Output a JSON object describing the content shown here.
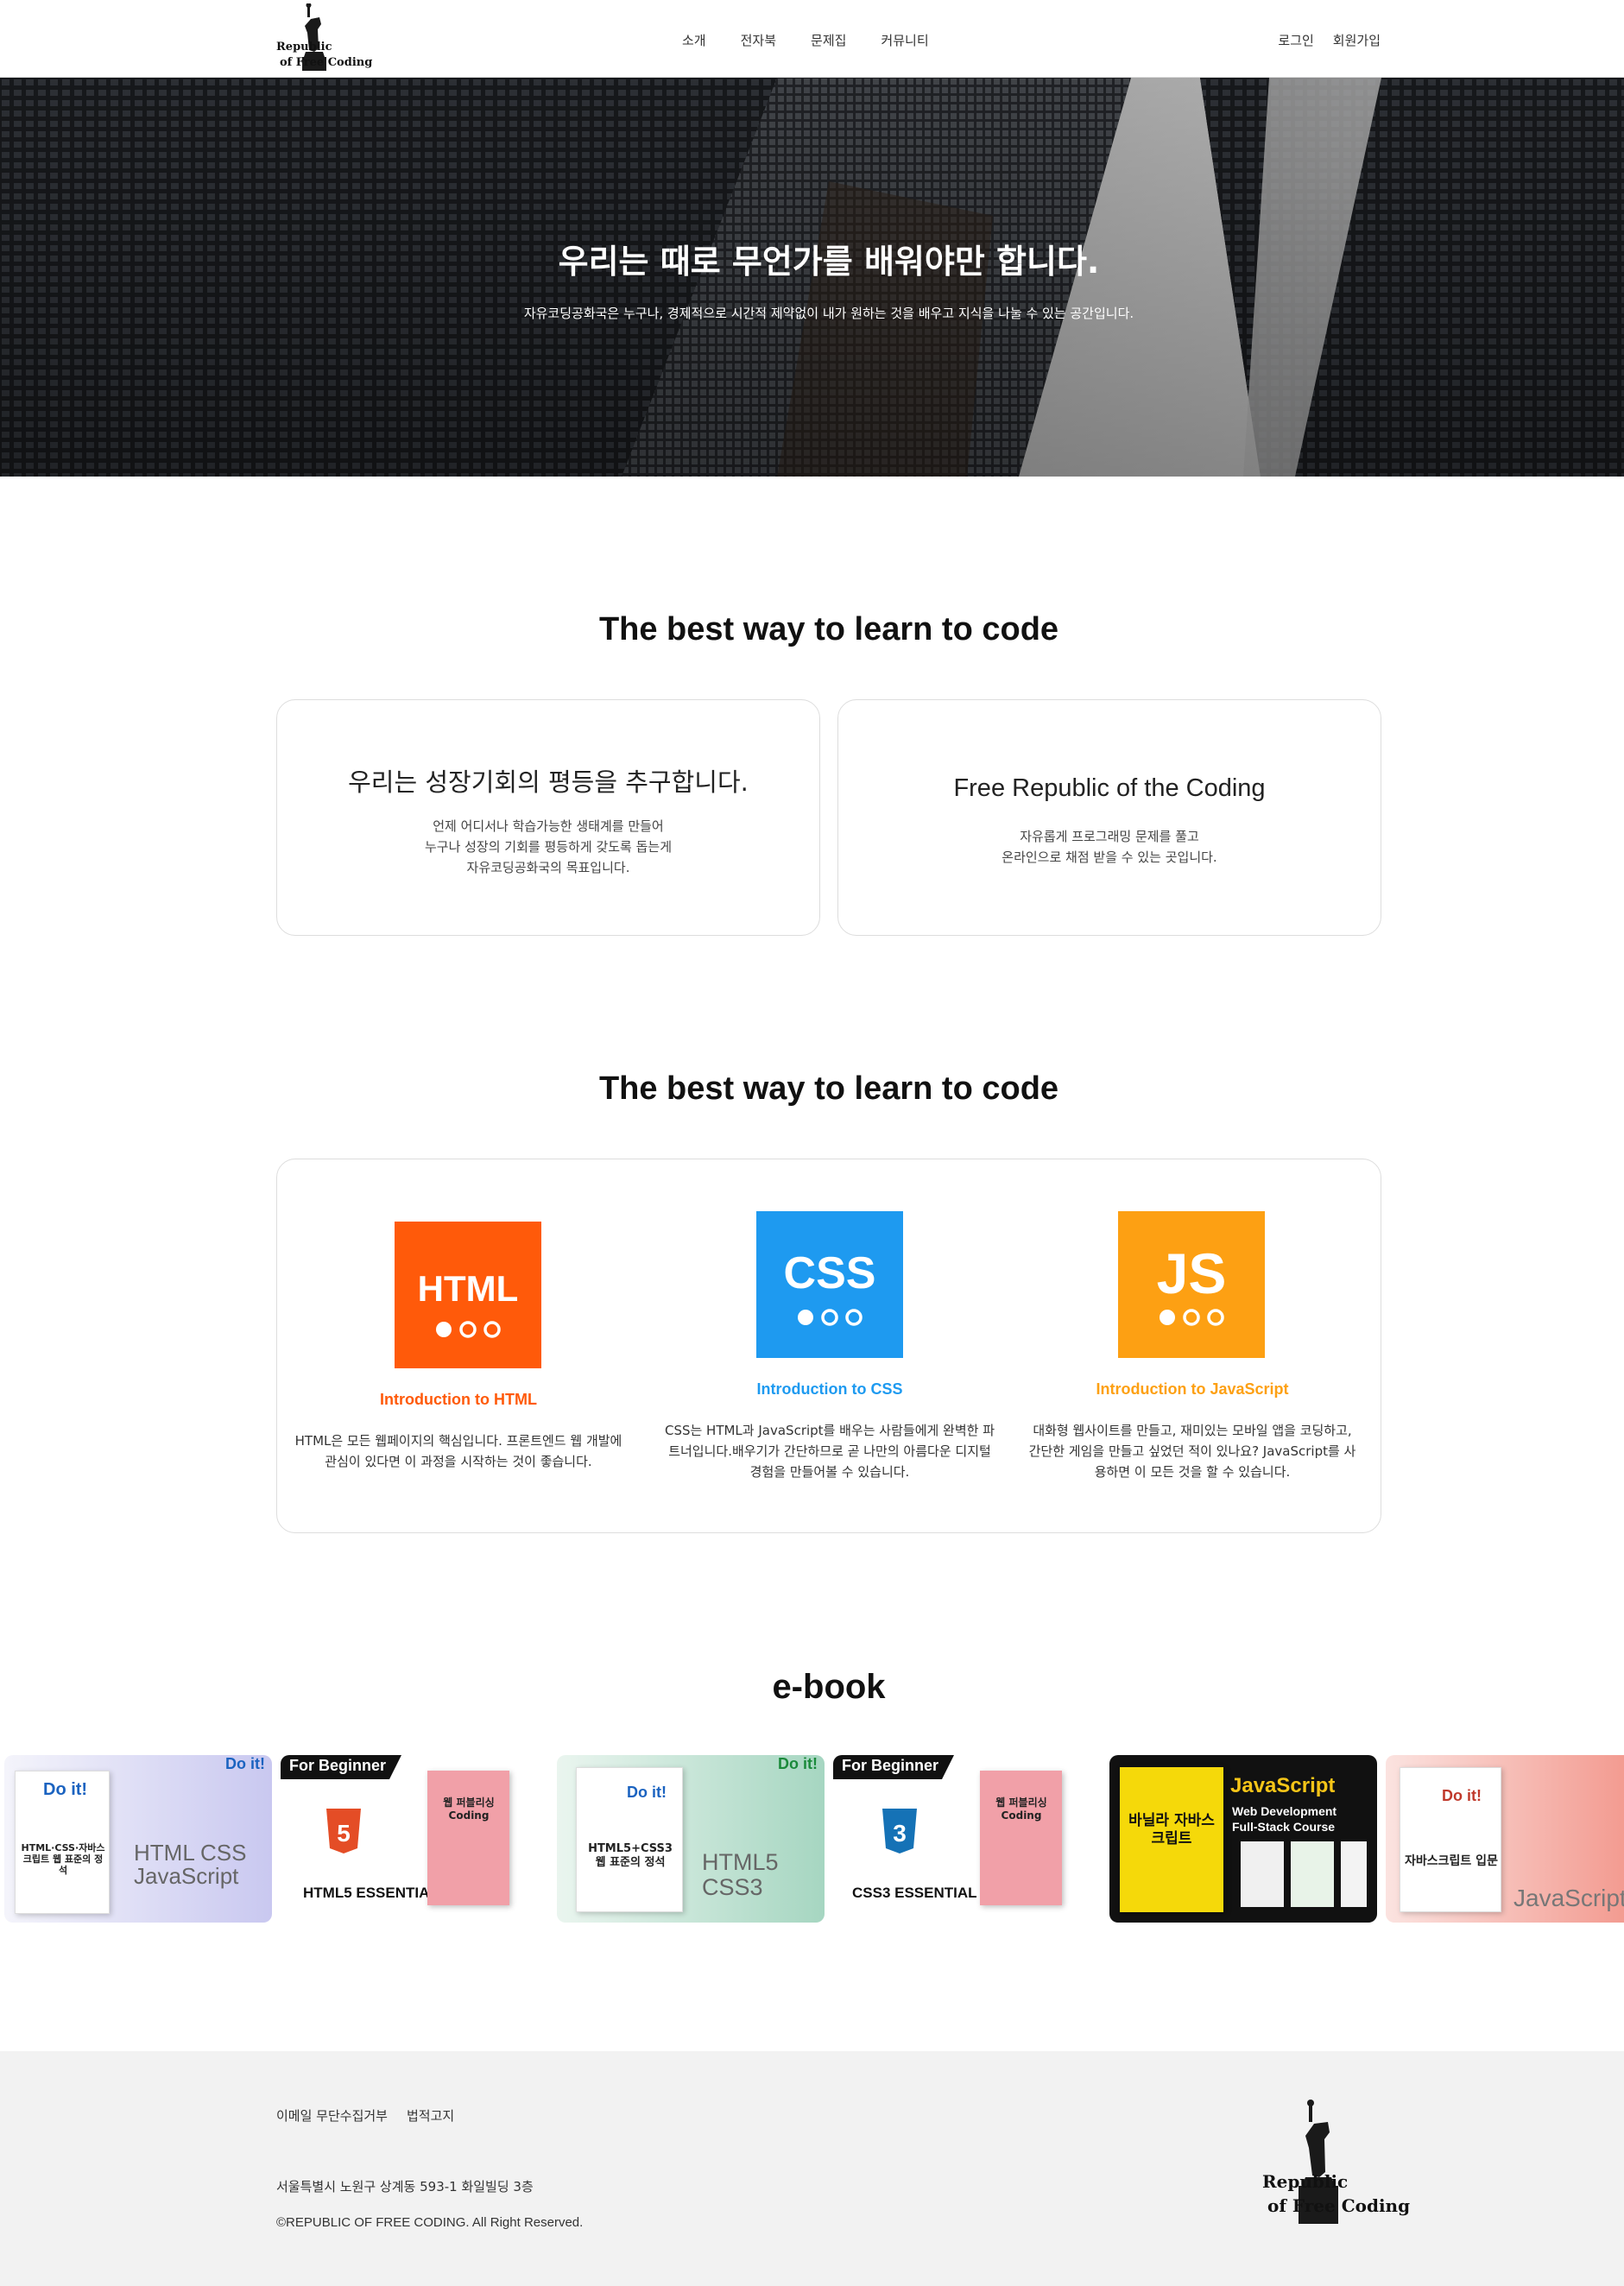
{
  "header": {
    "logo_line1": "Republic",
    "logo_line2": "of Free Coding",
    "nav": [
      "소개",
      "전자북",
      "문제집",
      "커뮤니티"
    ],
    "login": "로그인",
    "signup": "회원가입"
  },
  "hero": {
    "title": "우리는 때로 무언가를 배워야만 합니다.",
    "subtitle": "자유코딩공화국은 누구나, 경제적으로 시간적 제약없이 내가 원하는 것을 배우고 지식을 나눌 수 있는 공간입니다."
  },
  "section1": {
    "title": "The best way to learn to code",
    "cards": [
      {
        "title": "우리는 성장기회의 평등을 추구합니다.",
        "lines": [
          "언제 어디서나 학습가능한 생태계를 만들어",
          "누구나 성장의 기회를 평등하게 갖도록 돕는게",
          "자유코딩공화국의 목표입니다."
        ]
      },
      {
        "title": "Free Republic of the Coding",
        "lines": [
          "자유롭게 프로그래밍 문제를 풀고",
          "온라인으로 채점 받을 수 있는 곳입니다."
        ]
      }
    ]
  },
  "section2": {
    "title": "The best way to learn to code",
    "courses": [
      {
        "tile_label": "HTML",
        "title": "Introduction to HTML",
        "color": "#ff5a0a",
        "lines": [
          "HTML은 모든 웹페이지의 핵심입니다. 프론트엔드 웹 개발에",
          "관심이 있다면 이 과정을 시작하는 것이 좋습니다."
        ]
      },
      {
        "tile_label": "CSS",
        "title": "Introduction to CSS",
        "color": "#1e9af0",
        "lines": [
          "CSS는 HTML과 JavaScript를 배우는 사람들에게 완벽한 파",
          "트너입니다.배우기가 간단하므로 곧 나만의 아름다운 디지털",
          "경험을 만들어볼 수 있습니다."
        ]
      },
      {
        "tile_label": "JS",
        "title": "Introduction to JavaScript",
        "color": "#fda013",
        "lines": [
          "대화형 웹사이트를 만들고, 재미있는 모바일 앱을 코딩하고,",
          "간단한 게임을 만들고 싶었던 적이 있나요? JavaScript를 사",
          "용하면 이 모든 것을 할 수 있습니다."
        ]
      }
    ]
  },
  "ebook": {
    "title": "e-book",
    "books": [
      {
        "tag": "Do it!",
        "title": "HTML CSS JavaScript",
        "cover": "HTML·CSS·자바스크립트 웹 표준의 정석"
      },
      {
        "tag": "For Beginner",
        "title": "HTML5 ESSENTIAL",
        "cover": "웹 퍼블리싱 Coding"
      },
      {
        "tag": "Do it!",
        "title": "HTML5 CSS3",
        "cover": "HTML5+CSS3 웹 표준의 정석"
      },
      {
        "tag": "For Beginner",
        "title": "CSS3 ESSENTIAL",
        "cover": "웹 퍼블리싱 Coding"
      },
      {
        "tag": "JavaScript",
        "title": "Web Development Full-Stack Course",
        "cover": "바닐라 자바스크립트"
      },
      {
        "tag": "Do it!",
        "title": "JavaScript",
        "cover": "자바스크립트 입문"
      }
    ]
  },
  "footer": {
    "links": [
      "이메일 무단수집거부",
      "법적고지"
    ],
    "address": "서울특별시 노원구 상계동 593-1 화일빌딩 3층",
    "copyright": "©REPUBLIC OF FREE CODING. All Right Reserved.",
    "logo_line1": "Republic",
    "logo_line2": "of Free Coding"
  }
}
